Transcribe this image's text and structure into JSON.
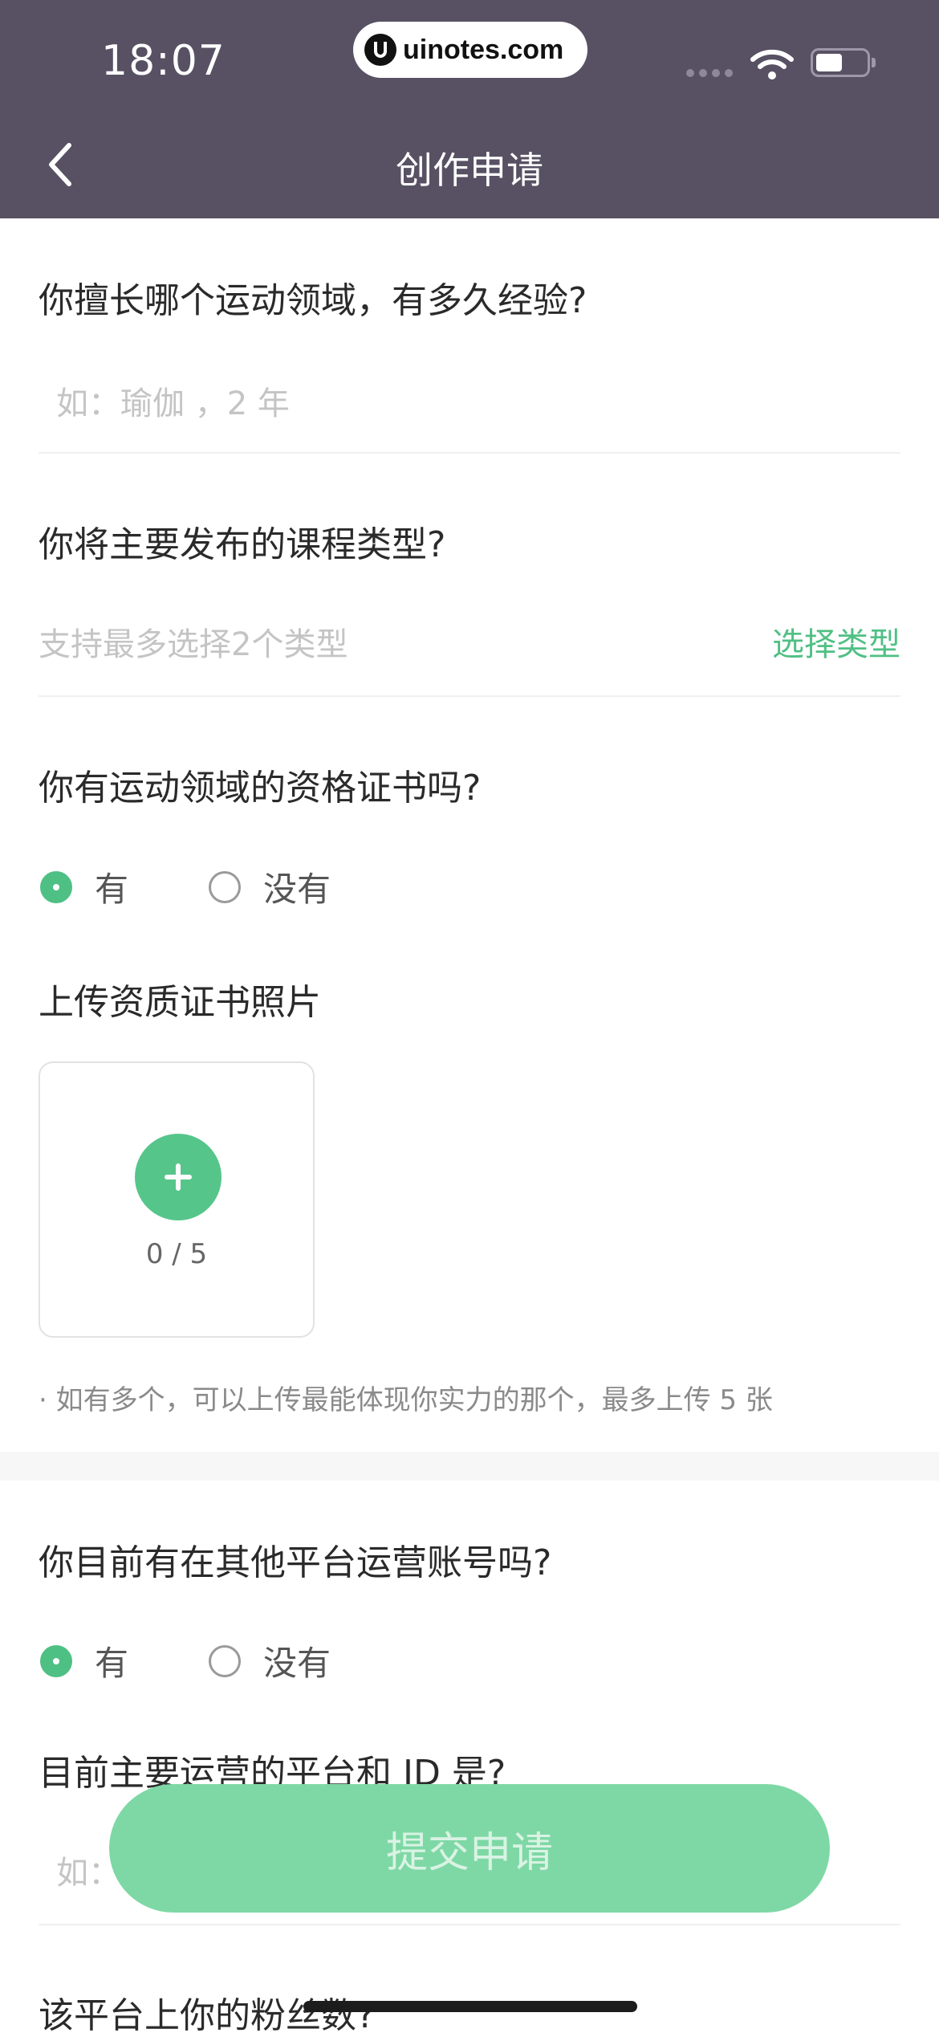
{
  "status_bar": {
    "time": "18:07",
    "url": "uinotes.com"
  },
  "nav": {
    "title": "创作申请"
  },
  "form": {
    "q1": {
      "question": "你擅长哪个运动领域，有多久经验?",
      "placeholder": "如：瑜伽 ，2 年"
    },
    "q2": {
      "question": "你将主要发布的课程类型?",
      "placeholder": "支持最多选择2个类型",
      "action": "选择类型"
    },
    "q3": {
      "question": "你有运动领域的资格证书吗?",
      "options": [
        "有",
        "没有"
      ],
      "selected": "有"
    },
    "upload": {
      "title": "上传资质证书照片",
      "count": "0 / 5",
      "hint": "· 如有多个，可以上传最能体现你实力的那个，最多上传 5 张"
    },
    "q4": {
      "question": "你目前有在其他平台运营账号吗?",
      "options": [
        "有",
        "没有"
      ],
      "selected": "有"
    },
    "q5": {
      "question": "目前主要运营的平台和 ID 是?",
      "placeholder": "如："
    },
    "q6": {
      "question": "该平台上你的粉丝数?"
    }
  },
  "submit": {
    "label": "提交申请"
  },
  "colors": {
    "header": "#575163",
    "accent": "#4fc084",
    "submit": "#7ed8a5"
  }
}
